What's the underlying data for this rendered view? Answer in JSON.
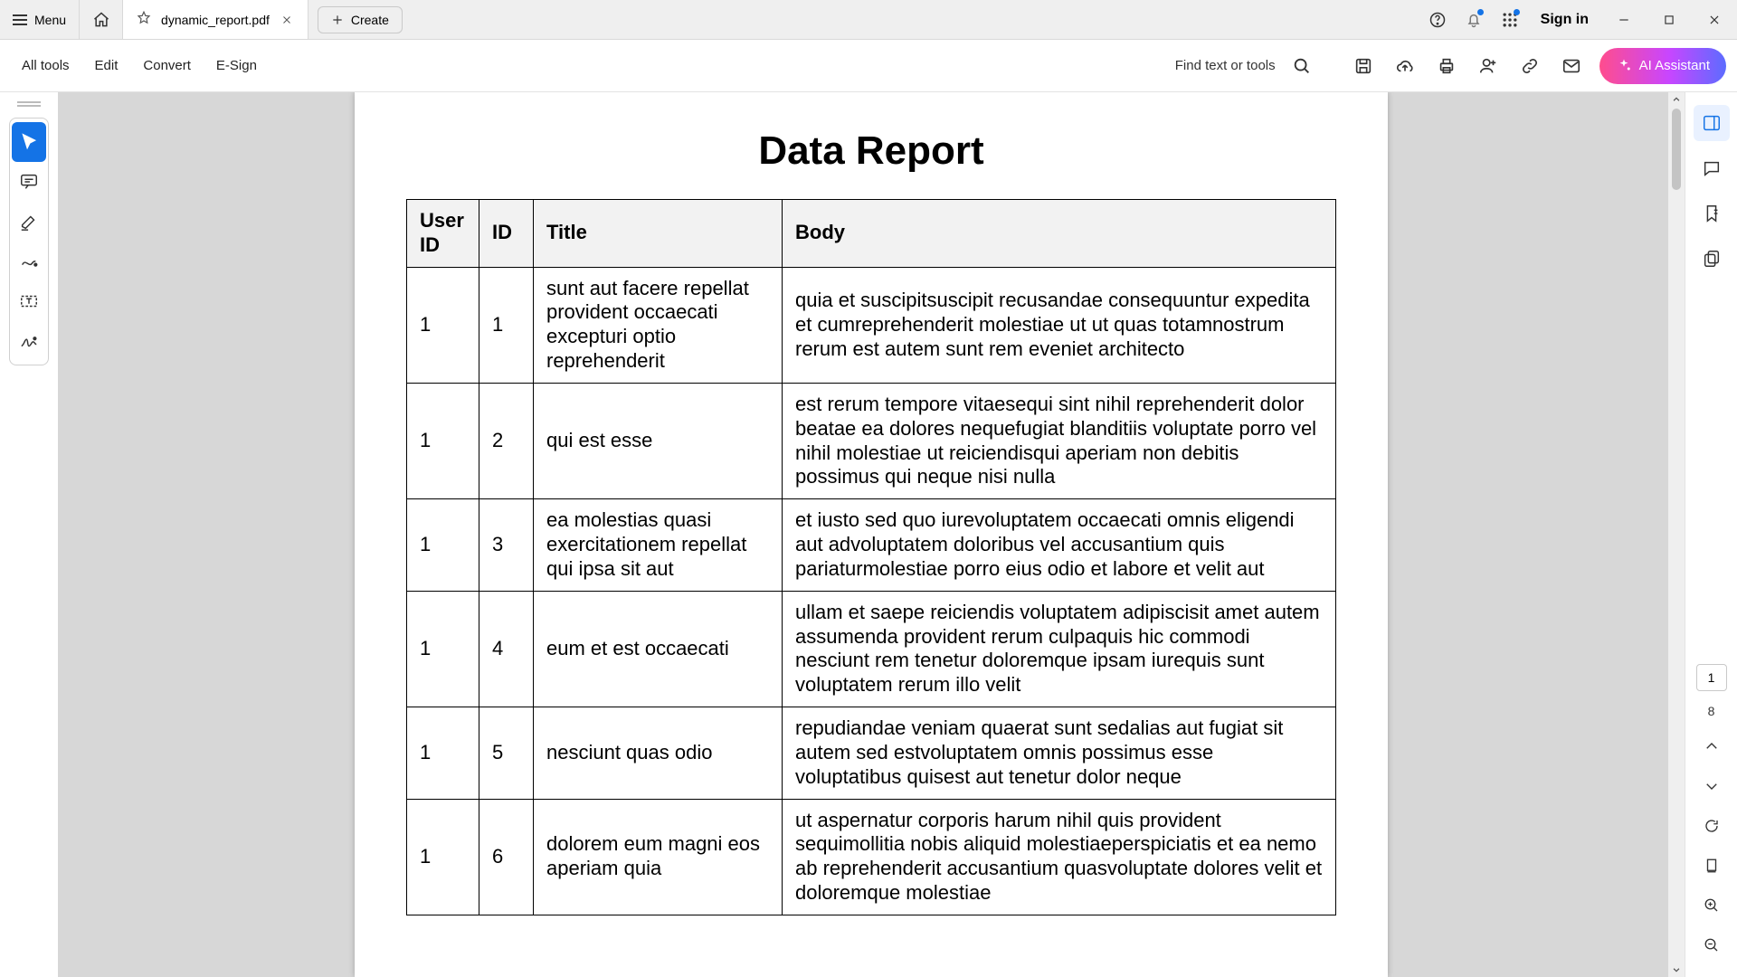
{
  "titlebar": {
    "menu_label": "Menu",
    "tab_filename": "dynamic_report.pdf",
    "create_label": "Create",
    "signin_label": "Sign in"
  },
  "toolbar": {
    "all_tools": "All tools",
    "edit": "Edit",
    "convert": "Convert",
    "esign": "E-Sign",
    "find_label": "Find text or tools",
    "ai_label": "AI Assistant"
  },
  "page_nav": {
    "current": "1",
    "total": "8"
  },
  "document": {
    "title": "Data Report",
    "columns": {
      "user_id": "User ID",
      "id": "ID",
      "title": "Title",
      "body": "Body"
    },
    "rows": [
      {
        "user_id": "1",
        "id": "1",
        "title": "sunt aut facere repellat provident occaecati excepturi optio reprehenderit",
        "body": "quia et suscipitsuscipit recusandae consequuntur expedita et cumreprehenderit molestiae ut ut quas totamnostrum rerum est autem sunt rem eveniet architecto"
      },
      {
        "user_id": "1",
        "id": "2",
        "title": "qui est esse",
        "body": "est rerum tempore vitaesequi sint nihil reprehenderit dolor beatae ea dolores nequefugiat blanditiis voluptate porro vel nihil molestiae ut reiciendisqui aperiam non debitis possimus qui neque nisi nulla"
      },
      {
        "user_id": "1",
        "id": "3",
        "title": "ea molestias quasi exercitationem repellat qui ipsa sit aut",
        "body": "et iusto sed quo iurevoluptatem occaecati omnis eligendi aut advoluptatem doloribus vel accusantium quis pariaturmolestiae porro eius odio et labore et velit aut"
      },
      {
        "user_id": "1",
        "id": "4",
        "title": "eum et est occaecati",
        "body": "ullam et saepe reiciendis voluptatem adipiscisit amet autem assumenda provident rerum culpaquis hic commodi nesciunt rem tenetur doloremque ipsam iurequis sunt voluptatem rerum illo velit"
      },
      {
        "user_id": "1",
        "id": "5",
        "title": "nesciunt quas odio",
        "body": "repudiandae veniam quaerat sunt sedalias aut fugiat sit autem sed estvoluptatem omnis possimus esse voluptatibus quisest aut tenetur dolor neque"
      },
      {
        "user_id": "1",
        "id": "6",
        "title": "dolorem eum magni eos aperiam quia",
        "body": "ut aspernatur corporis harum nihil quis provident sequimollitia nobis aliquid molestiaeperspiciatis et ea nemo ab reprehenderit accusantium quasvoluptate dolores velit et doloremque molestiae"
      }
    ]
  }
}
